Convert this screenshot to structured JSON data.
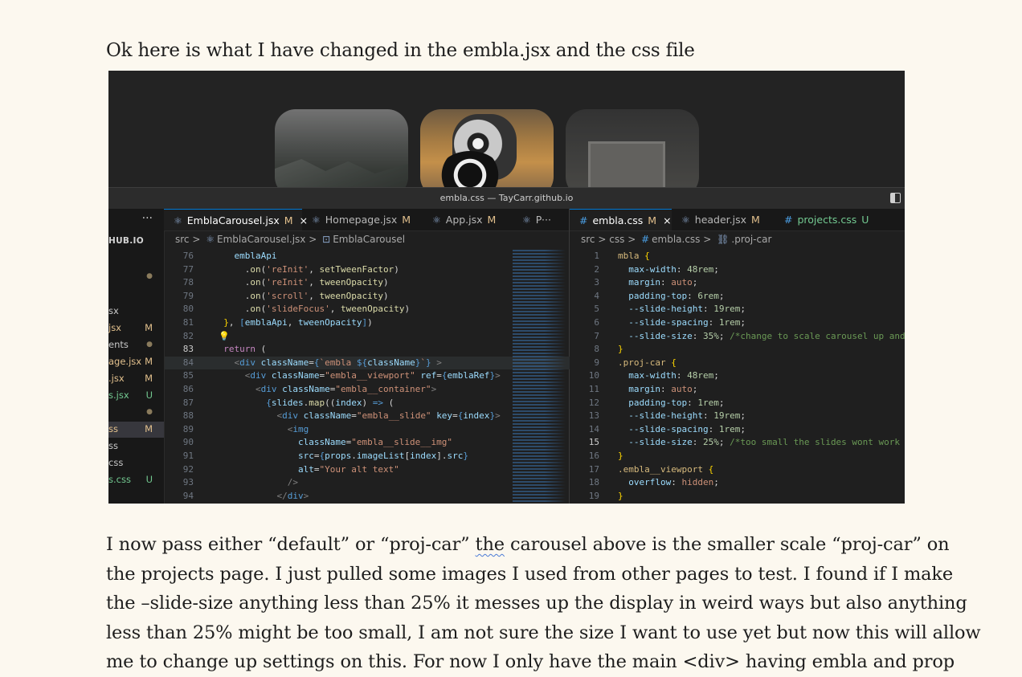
{
  "post": {
    "intro": "Ok here is what I have changed in the embla.jsx and the css file",
    "body_lines": [
      [
        "I now pass either “default” or “proj-car” ",
        "the",
        " carousel above is the smaller scale “proj-car” on"
      ],
      [
        "the projects page. I just pulled some images I used from other pages to test. I found if I make",
        "",
        ""
      ],
      [
        "the –slide-size anything less than 25% it messes up the display in weird ways but also anything",
        "",
        ""
      ],
      [
        "less than 25% might be too small, I am not sure the size I want to use yet but now this will allow",
        "",
        ""
      ],
      [
        "me to change up settings on this. For now I only have the main <div> having embla and prop",
        "",
        ""
      ]
    ]
  },
  "window": {
    "title": "embla.css — TayCarr.github.io"
  },
  "sidebar": {
    "header": "HUB.IO",
    "rows": [
      {
        "name": "",
        "badge": "●",
        "kind": "dot"
      },
      {
        "name": "sx",
        "badge": "",
        "kind": ""
      },
      {
        "name": "jsx",
        "badge": "M",
        "kind": "mod"
      },
      {
        "name": "ents",
        "badge": "●",
        "kind": "dot"
      },
      {
        "name": "age.jsx",
        "badge": "M",
        "kind": "mod"
      },
      {
        "name": ".jsx",
        "badge": "M",
        "kind": "mod"
      },
      {
        "name": "s.jsx",
        "badge": "U",
        "kind": "unt"
      },
      {
        "name": "",
        "badge": "●",
        "kind": "dot"
      },
      {
        "name": "ss",
        "badge": "M",
        "kind": "mod",
        "selected": true
      },
      {
        "name": "ss",
        "badge": "",
        "kind": ""
      },
      {
        "name": "css",
        "badge": "",
        "kind": ""
      },
      {
        "name": "s.css",
        "badge": "U",
        "kind": "unt"
      }
    ]
  },
  "left_editor": {
    "tabs": [
      {
        "icon": "⚛",
        "label": "EmblaCarousel.jsx",
        "status": "M",
        "close": "×",
        "active": true
      },
      {
        "icon": "⚛",
        "label": "Homepage.jsx",
        "status": "M",
        "close": "",
        "active": false
      },
      {
        "icon": "⚛",
        "label": "App.jsx",
        "status": "M",
        "close": "",
        "active": false
      },
      {
        "icon": "⚛",
        "label": "P",
        "status": "",
        "close": "",
        "active": false
      }
    ],
    "more": "···",
    "breadcrumb": {
      "a": "src",
      "sep1": ">",
      "b": "EmblaCarousel.jsx",
      "sep2": ">",
      "c": "EmblaCarousel"
    },
    "lines": [
      {
        "n": "76",
        "html": "    <span class='v'>emblaApi</span>"
      },
      {
        "n": "77",
        "html": "      .<span class='f'>on</span>(<span class='s'>'reInit'</span>, <span class='f'>setTweenFactor</span>)"
      },
      {
        "n": "78",
        "html": "      .<span class='f'>on</span>(<span class='s'>'reInit'</span>, <span class='f'>tweenOpacity</span>)"
      },
      {
        "n": "79",
        "html": "      .<span class='f'>on</span>(<span class='s'>'scroll'</span>, <span class='f'>tweenOpacity</span>)"
      },
      {
        "n": "80",
        "html": "      .<span class='f'>on</span>(<span class='s'>'slideFocus'</span>, <span class='f'>tweenOpacity</span>)"
      },
      {
        "n": "81",
        "html": "  <span class='p'>}</span>, <span class='t'>[</span><span class='v'>emblaApi</span>, <span class='v'>tweenOpacity</span><span class='t'>]</span>)"
      },
      {
        "n": "82",
        "html": ""
      },
      {
        "n": "83",
        "html": "  <span class='k'>return</span> (",
        "cur": true
      },
      {
        "n": "84",
        "html": "    <span class='tg'>&lt;</span><span class='t'>div</span> <span class='v'>className</span>=<span class='t'>{</span><span class='s'>`embla </span><span class='t'>${</span><span class='v'>className</span><span class='t'>}</span><span class='s'>`</span><span class='t'>}</span> <span class='tg'>&gt;</span>",
        "hl": true
      },
      {
        "n": "85",
        "html": "      <span class='tg'>&lt;</span><span class='t'>div</span> <span class='v'>className</span>=<span class='s'>\"embla__viewport\"</span> <span class='v'>ref</span>=<span class='t'>{</span><span class='v'>emblaRef</span><span class='t'>}</span><span class='tg'>&gt;</span>"
      },
      {
        "n": "86",
        "html": "        <span class='tg'>&lt;</span><span class='t'>div</span> <span class='v'>className</span>=<span class='s'>\"embla__container\"</span><span class='tg'>&gt;</span>"
      },
      {
        "n": "87",
        "html": "          <span class='t'>{</span><span class='v'>slides</span>.<span class='f'>map</span>((<span class='v'>index</span>) <span class='t'>=&gt;</span> ("
      },
      {
        "n": "88",
        "html": "            <span class='tg'>&lt;</span><span class='t'>div</span> <span class='v'>className</span>=<span class='s'>\"embla__slide\"</span> <span class='v'>key</span>=<span class='t'>{</span><span class='v'>index</span><span class='t'>}</span><span class='tg'>&gt;</span>"
      },
      {
        "n": "89",
        "html": "              <span class='tg'>&lt;</span><span class='t'>img</span>"
      },
      {
        "n": "90",
        "html": "                <span class='v'>className</span>=<span class='s'>\"embla__slide__img\"</span>"
      },
      {
        "n": "91",
        "html": "                <span class='v'>src</span>=<span class='t'>{</span><span class='v'>props</span>.<span class='v'>imageList</span>[<span class='v'>index</span>].<span class='v'>src</span><span class='t'>}</span>"
      },
      {
        "n": "92",
        "html": "                <span class='v'>alt</span>=<span class='s'>\"Your alt text\"</span>"
      },
      {
        "n": "93",
        "html": "              <span class='tg'>/&gt;</span>"
      },
      {
        "n": "94",
        "html": "            <span class='tg'>&lt;/</span><span class='t'>div</span><span class='tg'>&gt;</span>"
      }
    ]
  },
  "right_editor": {
    "tabs": [
      {
        "icon": "#",
        "label": "embla.css",
        "status": "M",
        "close": "×",
        "active": true
      },
      {
        "icon": "⚛",
        "label": "header.jsx",
        "status": "M",
        "close": "",
        "active": false
      },
      {
        "icon": "#",
        "label": "projects.css",
        "status": "U",
        "close": "",
        "active": false,
        "green": true
      }
    ],
    "breadcrumb": {
      "a": "src",
      "sep1": ">",
      "b": "css",
      "sep2": ">",
      "c": "embla.css",
      "sep3": ">",
      "d": ".proj-car"
    },
    "lines": [
      {
        "n": "1",
        "html": "<span class='sel'>mbla</span> <span class='p'>{</span>"
      },
      {
        "n": "2",
        "html": "  <span class='v'>max-width</span>: <span class='num'>48rem</span>;"
      },
      {
        "n": "3",
        "html": "  <span class='v'>margin</span>: <span class='s'>auto</span>;"
      },
      {
        "n": "4",
        "html": "  <span class='v'>padding-top</span>: <span class='num'>6rem</span>;"
      },
      {
        "n": "5",
        "html": "  <span class='v'>--slide-height</span>: <span class='num'>19rem</span>;"
      },
      {
        "n": "6",
        "html": "  <span class='v'>--slide-spacing</span>: <span class='num'>1rem</span>;"
      },
      {
        "n": "7",
        "html": "  <span class='v'>--slide-size</span>: <span class='num'>35%</span>; <span class='c'>/*change to scale carousel up and</span>"
      },
      {
        "n": "8",
        "html": "<span class='p'>}</span>"
      },
      {
        "n": "9",
        "html": "<span class='sel'>.proj-car</span> <span class='p'>{</span>"
      },
      {
        "n": "10",
        "html": "  <span class='v'>max-width</span>: <span class='num'>48rem</span>;"
      },
      {
        "n": "11",
        "html": "  <span class='v'>margin</span>: <span class='s'>auto</span>;"
      },
      {
        "n": "12",
        "html": "  <span class='v'>padding-top</span>: <span class='num'>1rem</span>;"
      },
      {
        "n": "13",
        "html": "  <span class='v'>--slide-height</span>: <span class='num'>19rem</span>;"
      },
      {
        "n": "14",
        "html": "  <span class='v'>--slide-spacing</span>: <span class='num'>1rem</span>;"
      },
      {
        "n": "15",
        "html": "  <span class='v'>--slide-size</span>: <span class='num'>25%</span>; <span class='c'>/*too small the slides wont work</span>",
        "cur": true
      },
      {
        "n": "16",
        "html": "<span class='p'>}</span>"
      },
      {
        "n": "17",
        "html": "<span class='sel'>.embla__viewport</span> <span class='p'>{</span>"
      },
      {
        "n": "18",
        "html": "  <span class='v'>overflow</span>: <span class='s'>hidden</span>;"
      },
      {
        "n": "19",
        "html": "<span class='p'>}</span>"
      }
    ]
  }
}
